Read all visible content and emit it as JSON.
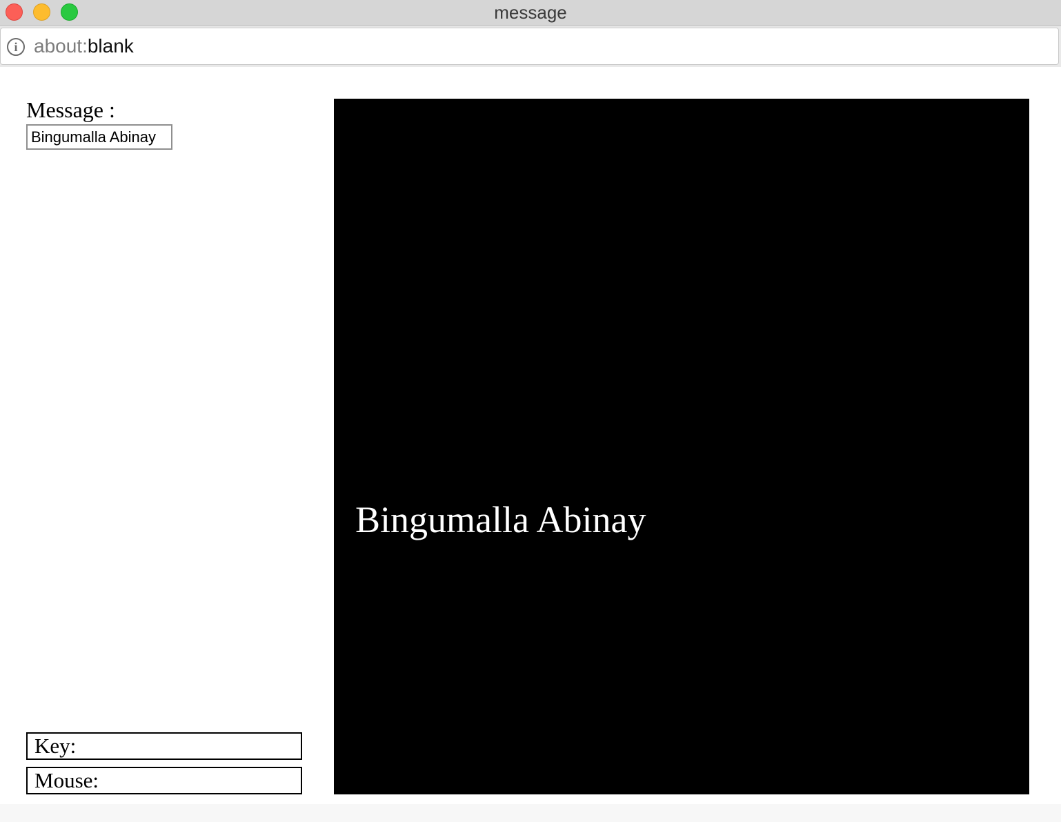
{
  "window": {
    "title": "message"
  },
  "address_bar": {
    "url_scheme": "about:",
    "url_path": "blank",
    "info_icon": "info-icon"
  },
  "form": {
    "message_label": "Message :",
    "message_value": "Bingumalla Abinay"
  },
  "status": {
    "key_label": "Key:",
    "mouse_label": "Mouse:"
  },
  "canvas": {
    "text": "Bingumalla Abinay",
    "background_color": "#000000",
    "text_color": "#ffffff"
  },
  "colors": {
    "close": "#fc5f57",
    "minimize": "#fdbc2e",
    "maximize": "#29c940"
  }
}
